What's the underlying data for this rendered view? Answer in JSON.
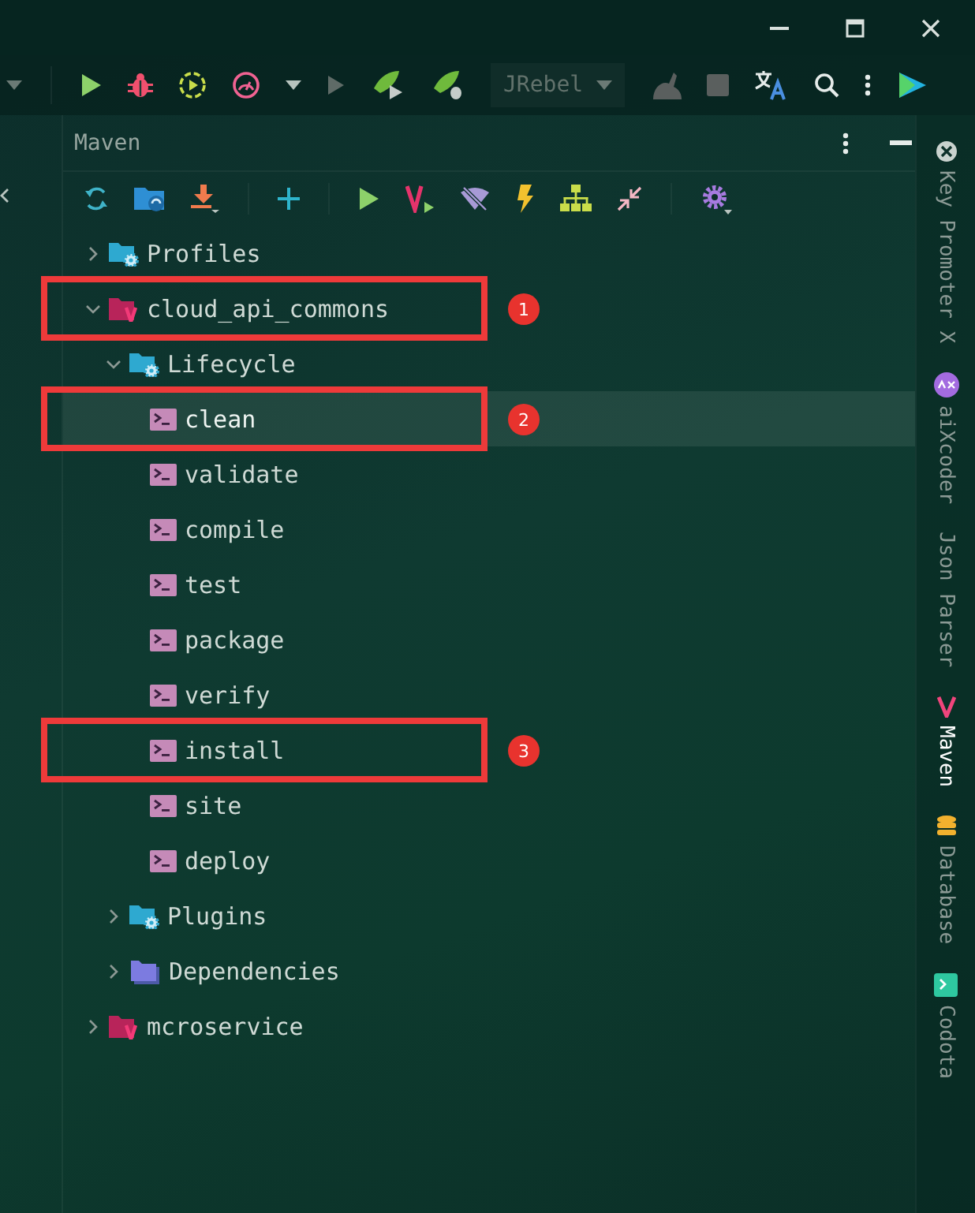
{
  "main_toolbar": {
    "run_config": {
      "label": "JRebel"
    }
  },
  "maven_panel": {
    "title": "Maven",
    "tree": [
      {
        "label": "Profiles",
        "kind": "folder-gear",
        "expanded": false,
        "selected": false
      },
      {
        "label": "cloud_api_commons",
        "kind": "maven-project",
        "expanded": true,
        "selected": false,
        "callout": "1",
        "children": [
          {
            "label": "Lifecycle",
            "kind": "folder-gear",
            "expanded": true,
            "selected": false,
            "children": [
              {
                "label": "clean",
                "kind": "goal",
                "selected": true,
                "callout": "2"
              },
              {
                "label": "validate",
                "kind": "goal",
                "selected": false
              },
              {
                "label": "compile",
                "kind": "goal",
                "selected": false
              },
              {
                "label": "test",
                "kind": "goal",
                "selected": false
              },
              {
                "label": "package",
                "kind": "goal",
                "selected": false
              },
              {
                "label": "verify",
                "kind": "goal",
                "selected": false
              },
              {
                "label": "install",
                "kind": "goal",
                "selected": false,
                "callout": "3"
              },
              {
                "label": "site",
                "kind": "goal",
                "selected": false
              },
              {
                "label": "deploy",
                "kind": "goal",
                "selected": false
              }
            ]
          },
          {
            "label": "Plugins",
            "kind": "folder-gear",
            "expanded": false,
            "selected": false
          },
          {
            "label": "Dependencies",
            "kind": "folder",
            "expanded": false,
            "selected": false
          }
        ]
      },
      {
        "label": "mcroservice",
        "kind": "maven-project",
        "expanded": false,
        "selected": false
      }
    ]
  },
  "side_tabs": [
    {
      "label": "Key Promoter X",
      "kind": "keypromoter",
      "selected": false
    },
    {
      "label": "aiXcoder",
      "kind": "aixcoder",
      "selected": false
    },
    {
      "label": "Json Parser",
      "kind": "none",
      "selected": false
    },
    {
      "label": "Maven",
      "kind": "maven",
      "selected": true
    },
    {
      "label": "Database",
      "kind": "database",
      "selected": false
    },
    {
      "label": "Codota",
      "kind": "codota",
      "selected": false
    }
  ]
}
